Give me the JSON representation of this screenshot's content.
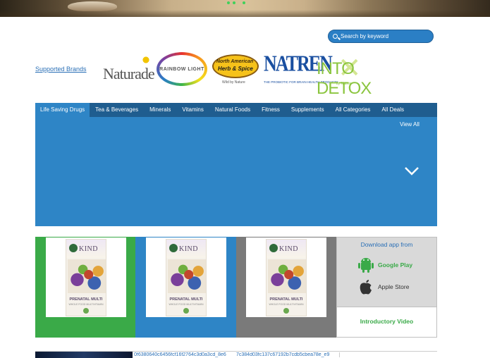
{
  "hero": {
    "slide_dots": 3
  },
  "search": {
    "placeholder": "Search by keyword"
  },
  "brands": {
    "supported_label": "Supported Brands",
    "items": [
      {
        "name": "Naturade"
      },
      {
        "name": "RAINBOW LIGHT"
      },
      {
        "name": "North American Herb & Spice",
        "line1": "North American",
        "line2": "Herb & Spice",
        "tagline": "Wild by Nature"
      },
      {
        "name": "NATREN",
        "tagline": "THE PROBIOTIC FOR BRAIN HEALTH PRODUCTS"
      },
      {
        "name": "INTO DETOX",
        "tagline": "by Natren"
      }
    ]
  },
  "nav": {
    "tabs": [
      {
        "label": "Life Saving Drugs",
        "active": true
      },
      {
        "label": "Tea & Beverages"
      },
      {
        "label": "Minerals"
      },
      {
        "label": "Vitamins"
      },
      {
        "label": "Natural Foods"
      },
      {
        "label": "Fitness"
      },
      {
        "label": "Supplements"
      },
      {
        "label": "All Categories"
      },
      {
        "label": "All Deals"
      }
    ],
    "view_all": "View All"
  },
  "products": [
    {
      "brand": "KIND",
      "name": "PRENATAL MULTI",
      "sub": "WHOLE FOOD MULTIVITAMIN"
    },
    {
      "brand": "KIND",
      "name": "PRENATAL MULTI",
      "sub": "WHOLE FOOD MULTIVITAMIN"
    },
    {
      "brand": "KIND",
      "name": "PRENATAL MULTI",
      "sub": "WHOLE FOOD MULTIVITAMIN"
    }
  ],
  "app_panel": {
    "download_label": "Download app from",
    "google_play": "Google Play",
    "apple_store": "Apple Store",
    "intro_video": "Introductory Video"
  },
  "bottom_images": [
    {
      "alt": "0f6380640c6456fcf16f2764c3d0a3cd_8e6"
    },
    {
      "alt": "7c384d03fc137c67192b7cdb5cbea78e_e9"
    }
  ],
  "colors": {
    "green": "#3aaa48",
    "blue": "#2e85c6",
    "nav_dark": "#1f5d8f",
    "gray": "#7a7a7a"
  }
}
